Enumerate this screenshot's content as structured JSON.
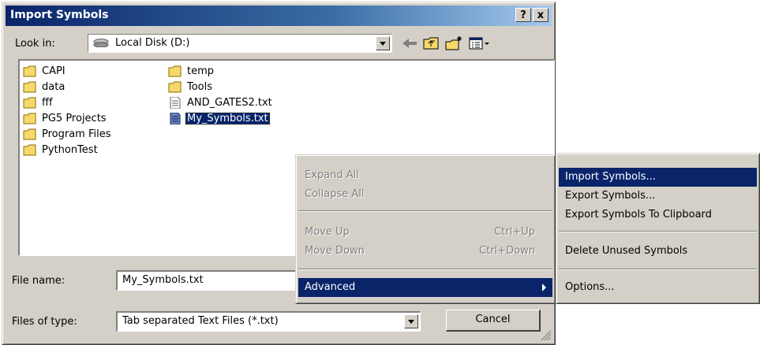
{
  "dialog": {
    "title": "Import Symbols",
    "help_button": "?",
    "close_button": "x",
    "look_in_label": "Look in:",
    "look_in_value": "Local Disk (D:)",
    "file_name_label": "File name:",
    "file_name_value": "My_Symbols.txt",
    "files_of_type_label": "Files of type:",
    "files_of_type_value": "Tab separated Text Files (*.txt)",
    "cancel_label": "Cancel"
  },
  "files": [
    {
      "name": "CAPI",
      "type": "folder"
    },
    {
      "name": "data",
      "type": "folder"
    },
    {
      "name": "fff",
      "type": "folder"
    },
    {
      "name": "PG5 Projects",
      "type": "folder"
    },
    {
      "name": "Program Files",
      "type": "folder"
    },
    {
      "name": "PythonTest",
      "type": "folder"
    },
    {
      "name": "temp",
      "type": "folder"
    },
    {
      "name": "Tools",
      "type": "folder"
    },
    {
      "name": "AND_GATES2.txt",
      "type": "text-file"
    },
    {
      "name": "My_Symbols.txt",
      "type": "text-file",
      "selected": true
    }
  ],
  "context_menu": {
    "expand_all": "Expand All",
    "collapse_all": "Collapse All",
    "move_up": "Move Up",
    "move_up_shortcut": "Ctrl+Up",
    "move_down": "Move Down",
    "move_down_shortcut": "Ctrl+Down",
    "advanced": "Advanced"
  },
  "submenu": {
    "import_symbols": "Import Symbols...",
    "export_symbols": "Export Symbols...",
    "export_to_clipboard": "Export Symbols To Clipboard",
    "delete_unused": "Delete Unused Symbols",
    "options": "Options..."
  },
  "colors": {
    "title_bar": "#0a246a",
    "window_face": "#d4d0c8",
    "highlight": "#0a246a",
    "folder": "#f7d96b"
  }
}
